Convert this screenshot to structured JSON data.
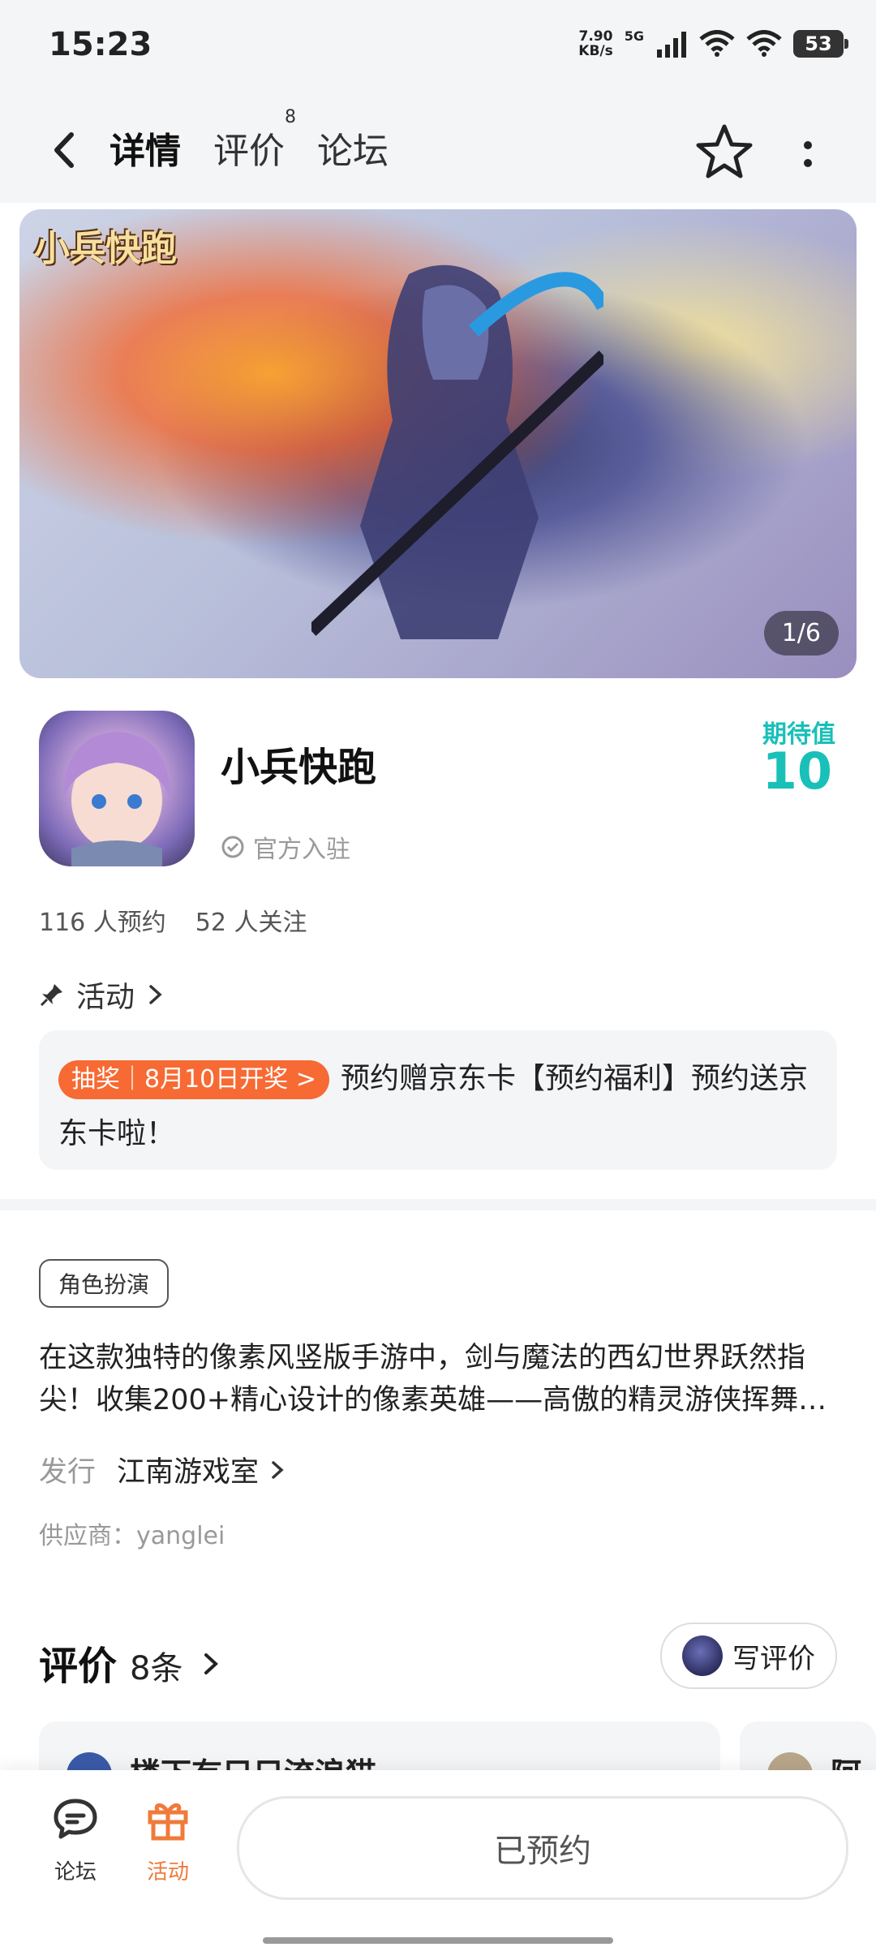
{
  "status_bar": {
    "time": "15:23",
    "net_speed_value": "7.90",
    "net_speed_unit": "KB/s",
    "network_type": "5G",
    "battery_level": "53"
  },
  "header": {
    "tabs": [
      {
        "label": "详情",
        "active": true
      },
      {
        "label": "评价",
        "badge": "8"
      },
      {
        "label": "论坛"
      }
    ]
  },
  "banner": {
    "logo_text": "小兵快跑",
    "counter": "1/6"
  },
  "app": {
    "name": "小兵快跑",
    "official_label": "官方入驻",
    "expect_label": "期待值",
    "expect_value": "10",
    "reservations": "116 人预约",
    "followers": "52 人关注"
  },
  "activity": {
    "title": "活动",
    "tag": "抽奖｜8月10日开奖 >",
    "text": "预约赠京东卡【预约福利】预约送京东卡啦！"
  },
  "details": {
    "genre": "角色扮演",
    "description": "在这款独特的像素风竖版手游中，剑与魔法的西幻世界跃然指尖！收集200+精心设计的像素英雄——高傲的精灵游侠挥舞…",
    "publisher_label": "发行",
    "publisher_name": "江南游戏室",
    "supplier": "供应商：yanglei"
  },
  "reviews": {
    "title": "评价",
    "count": "8条",
    "write_label": "写评价",
    "cards": [
      {
        "name": "楼下有只只流浪猫"
      },
      {
        "name": "阿言"
      }
    ]
  },
  "bottom_nav": {
    "forum_label": "论坛",
    "activity_label": "活动",
    "reserve_label": "已预约"
  },
  "colors": {
    "accent": "#18c0b8",
    "lottery": "#f76a33",
    "activity_icon": "#f07a3a"
  }
}
